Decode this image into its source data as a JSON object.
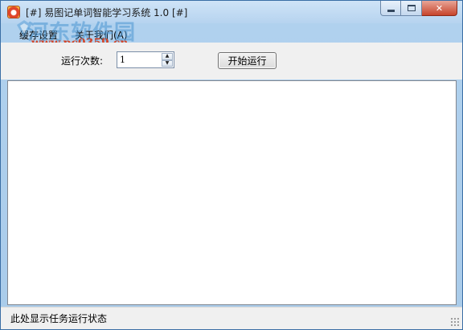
{
  "window": {
    "title": "[#] 易图记单词智能学习系统 1.0 [#]",
    "controls": {
      "minimize": "",
      "maximize": "",
      "close": "✕"
    }
  },
  "watermark": {
    "text": "河东软件园",
    "url": "www.pc0359.cn"
  },
  "menu": {
    "items": [
      {
        "label": "缓存设置"
      },
      {
        "label": "关于我们(A)"
      }
    ]
  },
  "toolbar": {
    "run_count_label": "运行次数:",
    "run_count_value": "1",
    "spin_up": "▲",
    "spin_down": "▼",
    "start_label": "开始运行"
  },
  "status": {
    "text": "此处显示任务运行状态"
  },
  "colors": {
    "title_gradient_top": "#cfe4f7",
    "close_button": "#c7442b",
    "watermark_blue": "#4b96d2",
    "watermark_red": "#d2462a"
  },
  "icons": [
    "app-icon",
    "minimize-icon",
    "maximize-icon",
    "close-icon",
    "spin-up-icon",
    "spin-down-icon",
    "resize-grip-icon",
    "watermark-logo-icon"
  ]
}
